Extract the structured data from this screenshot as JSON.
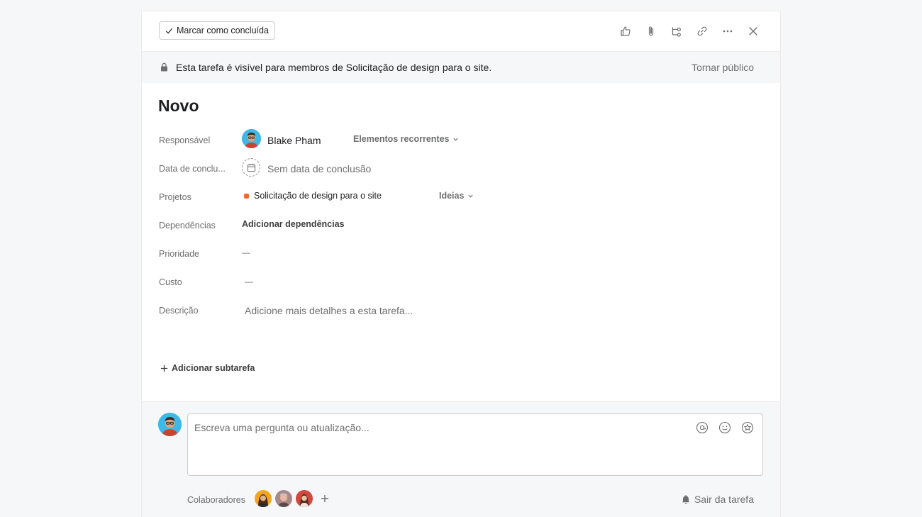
{
  "toolbar": {
    "complete_label": "Marcar como concluída",
    "icons": [
      "like-icon",
      "attachment-icon",
      "subtask-icon",
      "link-icon",
      "more-icon",
      "close-icon"
    ]
  },
  "banner": {
    "message": "Esta tarefa é visível para membros de Solicitação de design para o site.",
    "make_public": "Tornar público"
  },
  "task": {
    "title": "Novo"
  },
  "fields": {
    "assignee_label": "Responsável",
    "assignee_name": "Blake Pham",
    "recurring_label": "Elementos recorrentes",
    "due_label": "Data de conclu...",
    "due_value": "Sem data de conclusão",
    "projects_label": "Projetos",
    "project_name": "Solicitação de design para o site",
    "project_color": "#f06a35",
    "section_name": "Ideias",
    "dependencies_label": "Dependências",
    "dependencies_value": "Adicionar dependências",
    "priority_label": "Prioridade",
    "priority_value": "—",
    "cost_label": "Custo",
    "cost_value": "—",
    "description_label": "Descrição",
    "description_placeholder": "Adicione mais detalhes a esta tarefa..."
  },
  "subtask": {
    "add_label": "Adicionar subtarefa"
  },
  "comment": {
    "placeholder": "Escreva uma pergunta ou atualização...",
    "collaborators_label": "Colaboradores",
    "leave_label": "Sair da tarefa"
  }
}
